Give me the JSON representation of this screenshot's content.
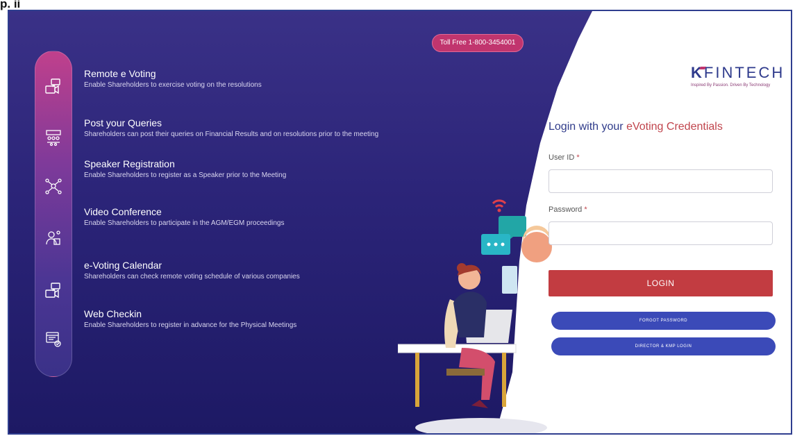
{
  "page": {
    "step_label": "p. ii"
  },
  "banner": {
    "toll_free": "Toll Free 1-800-3454001"
  },
  "features": [
    {
      "title": "Remote e Voting",
      "description": "Enable Shareholders to exercise voting on the resolutions",
      "icon": "video-chat-icon"
    },
    {
      "title": "Post your Queries",
      "description": "Shareholders can post their queries on Financial Results and on resolutions prior to the meeting",
      "icon": "queries-group-icon"
    },
    {
      "title": "Speaker Registration",
      "description": "Enable Shareholders to register as a Speaker prior to the Meeting",
      "icon": "speaker-network-icon"
    },
    {
      "title": "Video Conference",
      "description": "Enable Shareholders to participate in the AGM/EGM proceedings",
      "icon": "video-conference-icon"
    },
    {
      "title": "e-Voting Calendar",
      "description": "Shareholders can check remote voting schedule of various companies",
      "icon": "calendar-chat-icon"
    },
    {
      "title": "Web Checkin",
      "description": "Enable Shareholders to register in advance for the Physical Meetings",
      "icon": "web-checkin-icon"
    }
  ],
  "brand": {
    "logo_text": "FINTECH",
    "logo_initial": "K",
    "tagline": "Inspired By Passion. Driven By Technology"
  },
  "login": {
    "heading_prefix": "Login with your ",
    "heading_accent": "eVoting Credentials",
    "user_id_label": "User ID",
    "password_label": "Password",
    "required_mark": "*",
    "user_id_value": "",
    "password_value": "",
    "login_label": "LOGIN",
    "forgot_password_label": "FORGOT PASSWORD",
    "director_login_label": "DIRECTOR & KMP LOGIN"
  },
  "colors": {
    "panel": "#2b2478",
    "accent_red": "#c23c41",
    "pill_blue": "#3b4ab8",
    "toll_pink": "#c1356e"
  }
}
